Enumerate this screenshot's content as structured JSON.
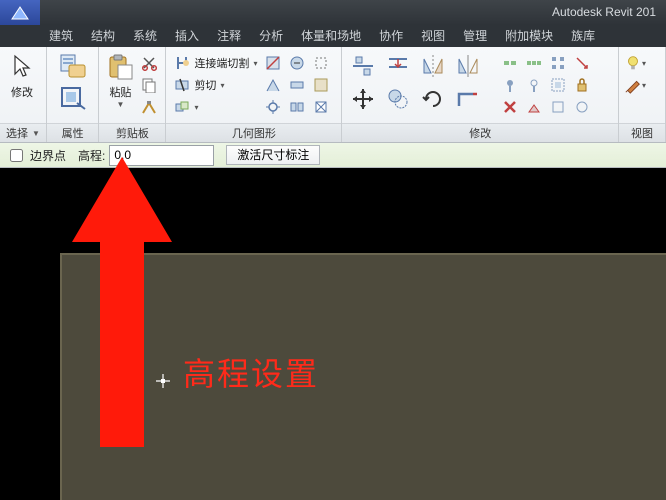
{
  "title": "Autodesk Revit 201",
  "menu": [
    "建筑",
    "结构",
    "系统",
    "插入",
    "注释",
    "分析",
    "体量和场地",
    "协作",
    "视图",
    "管理",
    "附加模块",
    "族库"
  ],
  "ribbon": {
    "select": {
      "label": "选择",
      "big": "修改"
    },
    "props": {
      "label": "属性"
    },
    "clip": {
      "label": "剪贴板",
      "big": "粘贴",
      "cut": "剪切",
      "joincut": "连接端切割"
    },
    "geom": {
      "label": "几何图形"
    },
    "modify": {
      "label": "修改"
    },
    "view": {
      "label": "视图"
    }
  },
  "opt": {
    "boundary": "边界点",
    "elev_label": "高程:",
    "elev_value": "0.0",
    "dimbtn": "激活尺寸标注"
  },
  "annotation": "高程设置"
}
